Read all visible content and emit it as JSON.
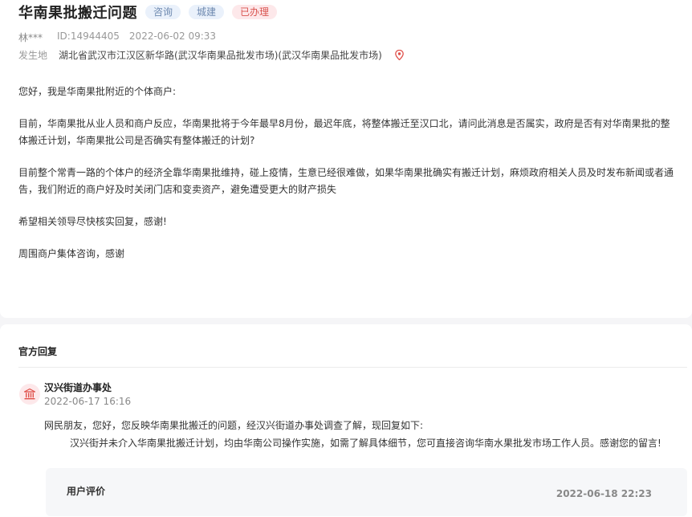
{
  "post": {
    "title": "华南果批搬迁问题",
    "tags": [
      {
        "label": "咨询",
        "color": "#6f8ab0"
      },
      {
        "label": "城建",
        "color": "#6f8ab0"
      },
      {
        "label": "已办理",
        "color": "#d9534f"
      }
    ],
    "author": "林***",
    "id": "ID:14944405",
    "datetime": "2022-06-02 09:33",
    "location_label": "发生地",
    "location": "湖北省武汉市江汉区新华路(武汉华南果品批发市场)(武汉华南果品批发市场)",
    "location_icon": "map-pin-icon",
    "paragraphs": [
      "您好，我是华南果批附近的个体商户:",
      "目前，华南果批从业人员和商户反应，华南果批将于今年最早8月份，最迟年底，将整体搬迁至汉口北，请问此消息是否属实，政府是否有对华南果批的整体搬迁计划，华南果批公司是否确实有整体搬迁的计划?",
      "目前整个常青一路的个体户的经济全靠华南果批维持，碰上疫情，生意已经很难做，如果华南果批确实有搬迁计划，麻烦政府相关人员及时发布新闻或者通告，我们附近的商户好及时关闭门店和变卖资产，避免遭受更大的财产损失",
      "希望相关领导尽快核实回复，感谢!",
      "周围商户集体咨询，感谢"
    ]
  },
  "official_reply": {
    "section_title": "官方回复",
    "department": "汉兴街道办事处",
    "department_icon": "government-building-icon",
    "datetime": "2022-06-17 16:16",
    "line1": "网民朋友，您好，您反映华南果批搬迁的问题，经汉兴街道办事处调查了解，现回复如下:",
    "line2": "汉兴街并未介入华南果批搬迁计划，均由华南公司操作实施，如需了解具体细节，您可直接咨询华南水果批发市场工作人员。感谢您的留言!"
  },
  "user_rating": {
    "label": "用户评价",
    "datetime": "2022-06-18 22:23"
  }
}
